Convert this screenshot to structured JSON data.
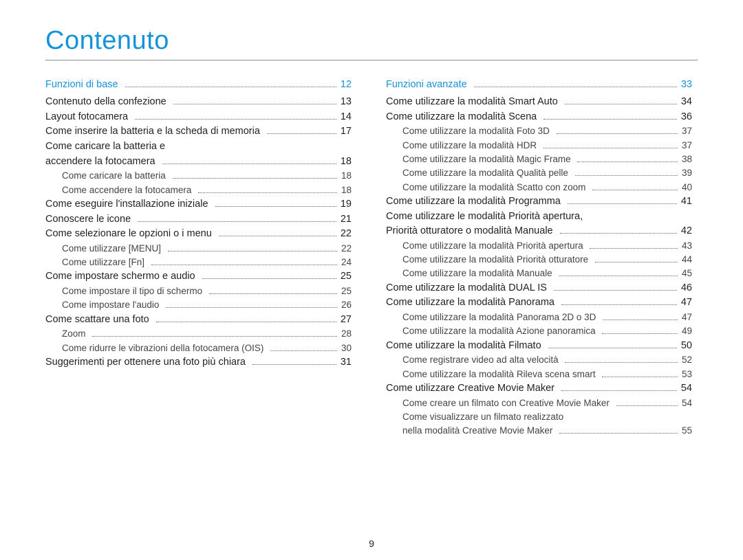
{
  "title": "Contenuto",
  "page_number": "9",
  "left": [
    {
      "level": "section",
      "label": "Funzioni di base",
      "page": "12"
    },
    {
      "level": "item",
      "label": "Contenuto della confezione",
      "page": "13"
    },
    {
      "level": "item",
      "label": "Layout fotocamera",
      "page": "14"
    },
    {
      "level": "item",
      "label": "Come inserire la batteria e la scheda di memoria",
      "page": "17"
    },
    {
      "level": "item",
      "label": "Come caricare la batteria e",
      "page": null
    },
    {
      "level": "item",
      "label": "accendere la fotocamera",
      "page": "18"
    },
    {
      "level": "sub",
      "label": "Come caricare la batteria",
      "page": "18"
    },
    {
      "level": "sub",
      "label": "Come accendere la fotocamera",
      "page": "18"
    },
    {
      "level": "item",
      "label": "Come eseguire l'installazione iniziale",
      "page": "19"
    },
    {
      "level": "item",
      "label": "Conoscere le icone",
      "page": "21"
    },
    {
      "level": "item",
      "label": "Come selezionare le opzioni o i menu",
      "page": "22"
    },
    {
      "level": "sub",
      "label": "Come utilizzare [MENU]",
      "page": "22"
    },
    {
      "level": "sub",
      "label": "Come utilizzare [Fn]",
      "page": "24"
    },
    {
      "level": "item",
      "label": "Come impostare schermo e audio",
      "page": "25"
    },
    {
      "level": "sub",
      "label": "Come impostare il tipo di schermo",
      "page": "25"
    },
    {
      "level": "sub",
      "label": "Come impostare l'audio",
      "page": "26"
    },
    {
      "level": "item",
      "label": "Come scattare una foto",
      "page": "27"
    },
    {
      "level": "sub",
      "label": "Zoom",
      "page": "28"
    },
    {
      "level": "sub",
      "label": "Come ridurre le vibrazioni della fotocamera (OIS)",
      "page": "30"
    },
    {
      "level": "item",
      "label": "Suggerimenti per ottenere una foto più chiara",
      "page": "31"
    }
  ],
  "right": [
    {
      "level": "section",
      "label": "Funzioni avanzate",
      "page": "33"
    },
    {
      "level": "item",
      "label": "Come utilizzare la modalità Smart Auto",
      "page": "34"
    },
    {
      "level": "item",
      "label": "Come utilizzare la modalità Scena",
      "page": "36"
    },
    {
      "level": "sub",
      "label": "Come utilizzare la modalità Foto 3D",
      "page": "37"
    },
    {
      "level": "sub",
      "label": "Come utilizzare la modalità HDR",
      "page": "37"
    },
    {
      "level": "sub",
      "label": "Come utilizzare la modalità Magic Frame",
      "page": "38"
    },
    {
      "level": "sub",
      "label": "Come utilizzare la modalità Qualità pelle",
      "page": "39"
    },
    {
      "level": "sub",
      "label": "Come utilizzare la modalità Scatto con zoom",
      "page": "40"
    },
    {
      "level": "item",
      "label": "Come utilizzare la modalità Programma",
      "page": "41"
    },
    {
      "level": "item",
      "label": "Come utilizzare le modalità Priorità apertura,",
      "page": null
    },
    {
      "level": "item",
      "label": "Priorità otturatore o modalità Manuale",
      "page": "42"
    },
    {
      "level": "sub",
      "label": "Come utilizzare la modalità Priorità apertura",
      "page": "43"
    },
    {
      "level": "sub",
      "label": "Come utilizzare la modalità Priorità otturatore",
      "page": "44"
    },
    {
      "level": "sub",
      "label": "Come utilizzare la modalità Manuale",
      "page": "45"
    },
    {
      "level": "item",
      "label": "Come utilizzare la modalità DUAL IS",
      "page": "46"
    },
    {
      "level": "item",
      "label": "Come utilizzare la modalità Panorama",
      "page": "47"
    },
    {
      "level": "sub",
      "label": "Come utilizzare la modalità Panorama 2D o 3D",
      "page": "47"
    },
    {
      "level": "sub",
      "label": "Come utilizzare la modalità Azione panoramica",
      "page": "49"
    },
    {
      "level": "item",
      "label": "Come utilizzare la modalità Filmato",
      "page": "50"
    },
    {
      "level": "sub",
      "label": "Come registrare video ad alta velocità",
      "page": "52"
    },
    {
      "level": "sub",
      "label": "Come utilizzare la modalità Rileva scena smart",
      "page": "53"
    },
    {
      "level": "item",
      "label": "Come utilizzare Creative Movie Maker",
      "page": "54"
    },
    {
      "level": "sub",
      "label": "Come creare un filmato con Creative Movie Maker",
      "page": "54"
    },
    {
      "level": "sub",
      "label": "Come visualizzare un filmato realizzato",
      "page": null
    },
    {
      "level": "sub",
      "label": "nella modalità Creative Movie Maker",
      "page": "55"
    }
  ]
}
